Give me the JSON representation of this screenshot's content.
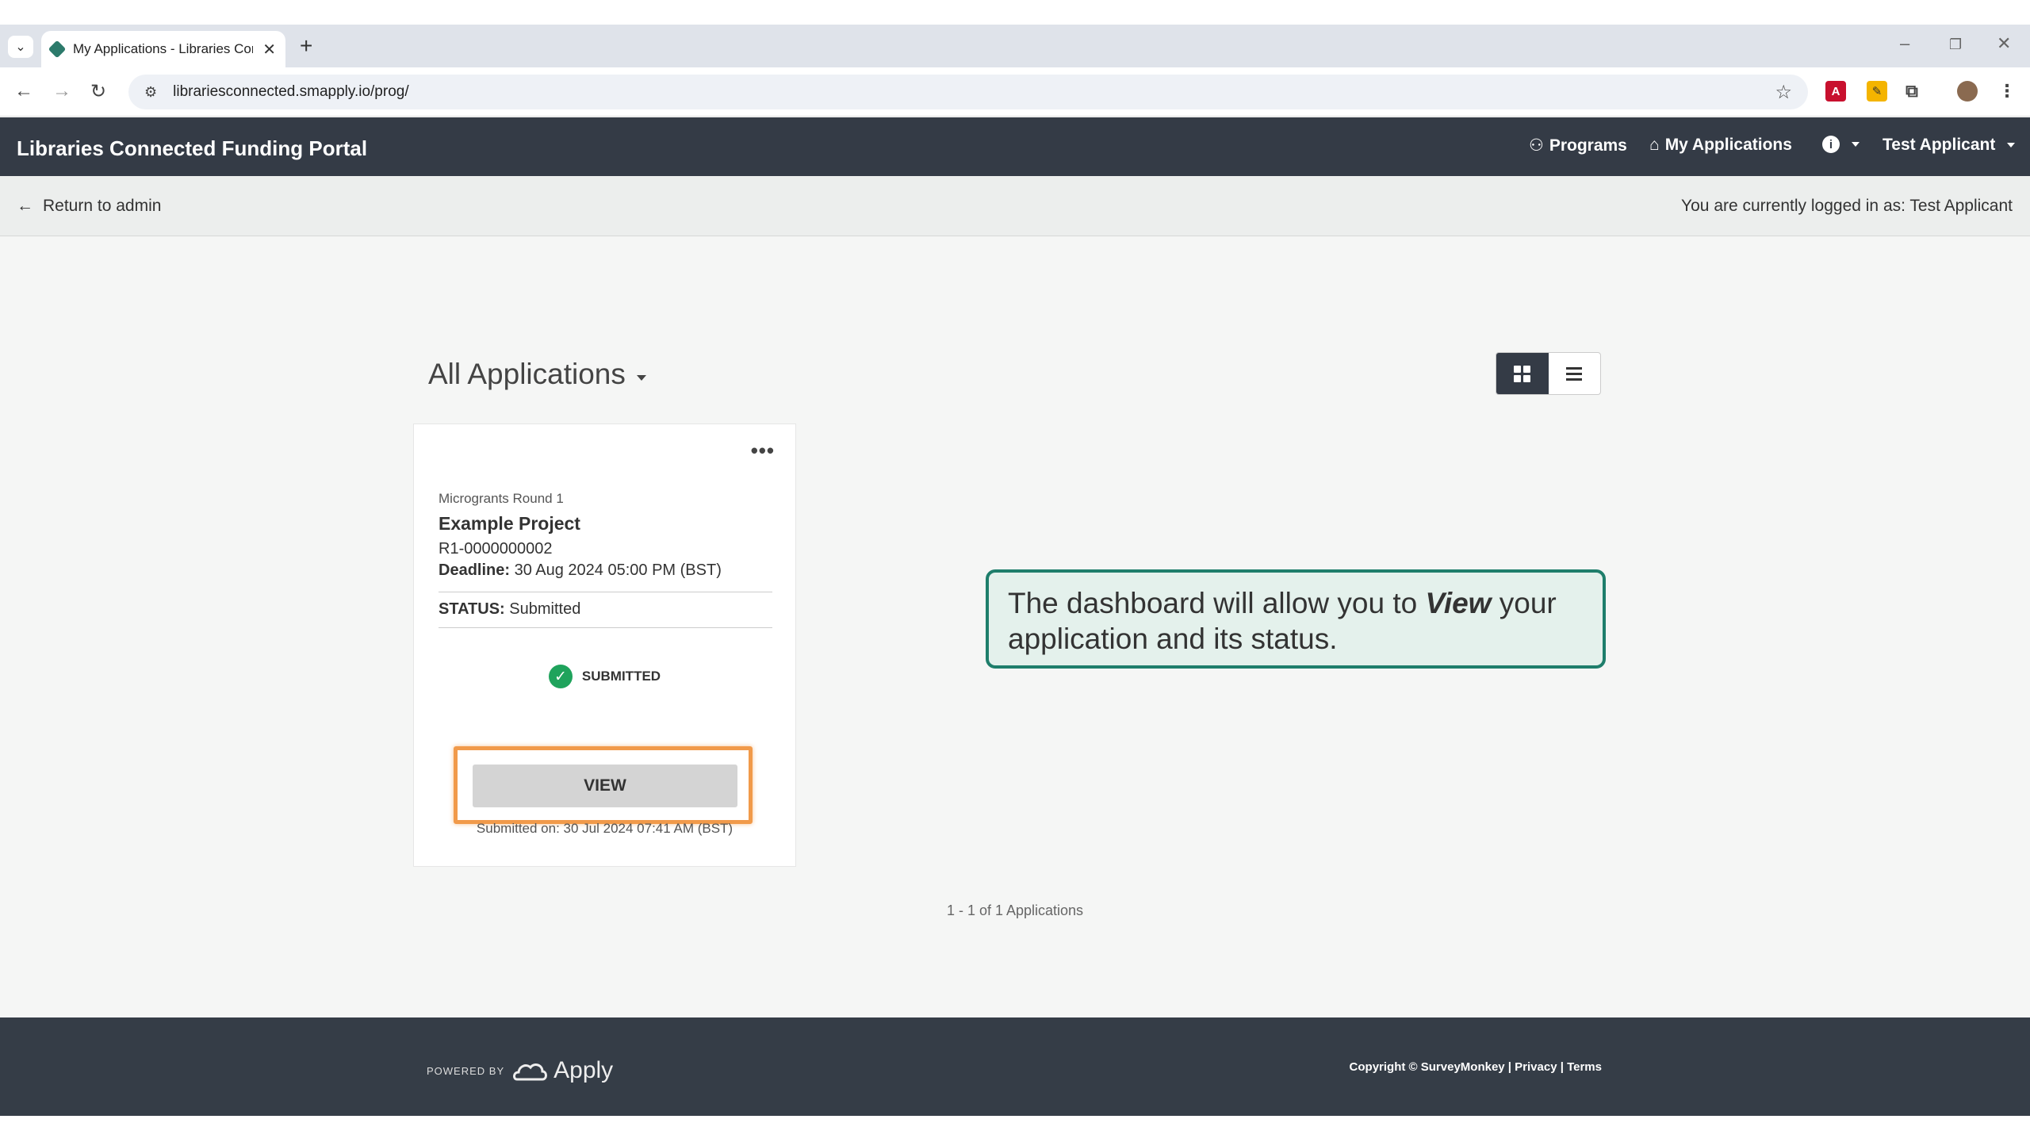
{
  "browser": {
    "tab_title": "My Applications - Libraries Con",
    "tab_close": "✕",
    "new_tab": "+",
    "url": "librariesconnected.smapply.io/prog/",
    "win_minimize": "–",
    "win_restore": "❐",
    "win_close": "✕"
  },
  "header": {
    "brand": "Libraries Connected Funding Portal",
    "nav": {
      "programs": "Programs",
      "my_applications": "My Applications",
      "user": "Test Applicant"
    }
  },
  "subbar": {
    "return_label": "Return to admin",
    "logged_in": "You are currently logged in as: Test Applicant"
  },
  "main": {
    "filter_label": "All Applications",
    "card": {
      "round": "Microgrants Round 1",
      "project_name": "Example Project",
      "project_id": "R1-0000000002",
      "deadline_label": "Deadline:",
      "deadline_value": "30 Aug 2024 05:00 PM (BST)",
      "status_label": "STATUS:",
      "status_value": "Submitted",
      "badge": "SUBMITTED",
      "view_label": "VIEW",
      "submitted_on": "Submitted on: 30 Jul 2024 07:41 AM (BST)"
    },
    "pager": "1 - 1 of 1 Applications"
  },
  "callout": {
    "before": "The dashboard will allow you to ",
    "emphasis": "View",
    "after": " your application and its status."
  },
  "footer": {
    "powered_by": "POWERED BY",
    "logo_text": "Apply",
    "copyright": "Copyright © SurveyMonkey | Privacy | Terms"
  },
  "colors": {
    "header_bg": "#343b46",
    "accent_teal": "#1e7e6b",
    "highlight_orange": "#f19a4a",
    "success_green": "#1fa35c"
  }
}
